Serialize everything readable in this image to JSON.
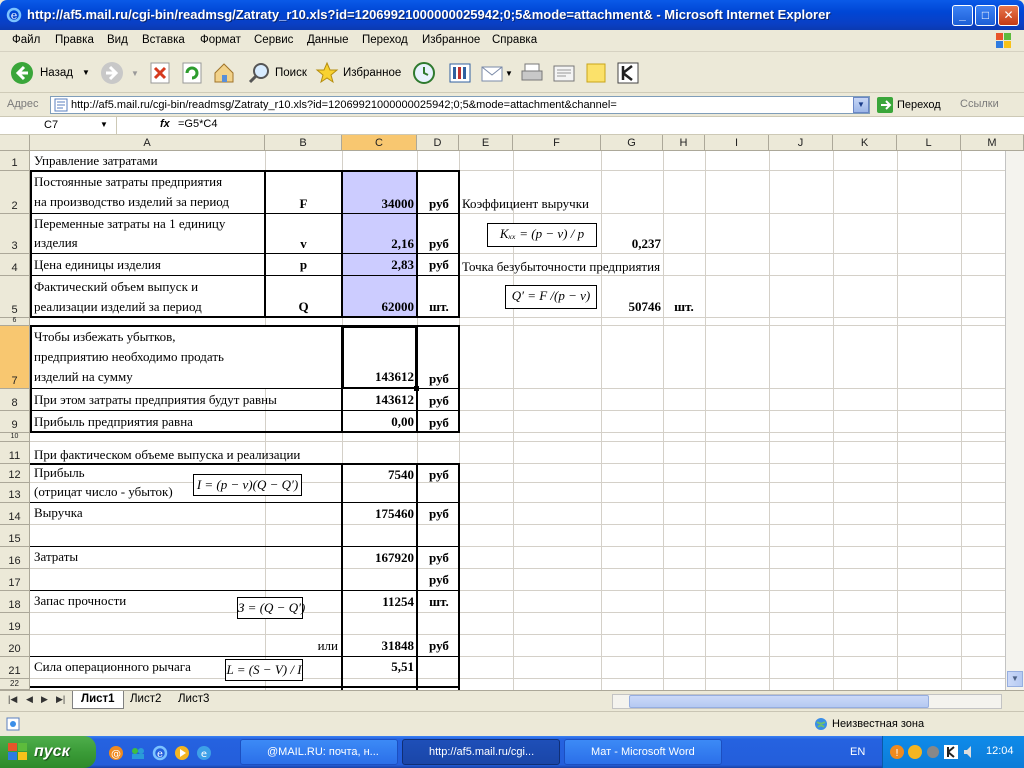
{
  "window": {
    "title": "http://af5.mail.ru/cgi-bin/readmsg/Zatraty_r10.xls?id=12069921000000025942;0;5&mode=attachment& - Microsoft Internet Explorer"
  },
  "menu": [
    "Файл",
    "Правка",
    "Вид",
    "Вставка",
    "Формат",
    "Сервис",
    "Данные",
    "Переход",
    "Избранное",
    "Справка"
  ],
  "toolbar": {
    "back": "Назад",
    "search": "Поиск",
    "favorites": "Избранное"
  },
  "address": {
    "label": "Адрес",
    "url": "http://af5.mail.ru/cgi-bin/readmsg/Zatraty_r10.xls?id=12069921000000025942;0;5&mode=attachment&channel=",
    "go": "Переход",
    "links": "Ссылки"
  },
  "formula_bar": {
    "name_box": "C7",
    "fx": "fx",
    "formula": "=G5*C4"
  },
  "columns": [
    "A",
    "B",
    "C",
    "D",
    "E",
    "F",
    "G",
    "H",
    "I",
    "J",
    "K",
    "L",
    "M"
  ],
  "rows": [
    "1",
    "2",
    "3",
    "4",
    "5",
    "6",
    "7",
    "8",
    "9",
    "10",
    "11",
    "12",
    "13",
    "14",
    "15",
    "16",
    "17",
    "18",
    "19",
    "20",
    "21",
    "22"
  ],
  "sheet": {
    "r1_a": "Управление затратами",
    "r2_a1": "Постоянные затраты предприятия",
    "r2_a2": "на производство изделий за период",
    "r2_b": "F",
    "r2_c": "34000",
    "r2_d": "руб",
    "r2_e": "Коэффициент выручки",
    "r3_a1": "Переменные затраты на 1 единицу",
    "r3_a2": "изделия",
    "r3_b": "v",
    "r3_c": "2,16",
    "r3_d": "руб",
    "r3_formula": "Kₓₓ = (p − v) / p",
    "r3_g": "0,237",
    "r4_a": "Цена единицы изделия",
    "r4_b": "p",
    "r4_c": "2,83",
    "r4_d": "руб",
    "r4_e": "Точка безубыточности предприятия",
    "r5_a1": "Фактический объем выпуск и",
    "r5_a2": "реализации изделий за период",
    "r5_b": "Q",
    "r5_c": "62000",
    "r5_d": "шт.",
    "r5_formula": "Q′ = F /(p − v)",
    "r5_g": "50746",
    "r5_h": "шт.",
    "r7_a1": "Чтобы избежать убытков,",
    "r7_a2": "предприятию  необходимо продать",
    "r7_a3": "изделий на сумму",
    "r7_c": "143612",
    "r7_d": "руб",
    "r8_a": "При этом затраты предприятия будут равны",
    "r8_c": "143612",
    "r8_d": "руб",
    "r9_a": "Прибыль предприятия равна",
    "r9_c": "0,00",
    "r9_d": "руб",
    "r11_a": "При фактическом объеме выпуска и реализации",
    "r12_a": "Прибыль",
    "r12_c": "7540",
    "r12_d": "руб",
    "r13_a": "(отрицат число - убыток)",
    "r13_formula": "I = (p − v)(Q − Q′)",
    "r14_a": "Выручка",
    "r14_c": "175460",
    "r14_d": "руб",
    "r16_a": "Затраты",
    "r16_c": "167920",
    "r16_d": "руб",
    "r17_d": "руб",
    "r18_a": "Запас прочности",
    "r18_formula": "З = (Q − Q′)",
    "r18_c": "11254",
    "r18_d": "шт.",
    "r20_b": "или",
    "r20_c": "31848",
    "r20_d": "руб",
    "r21_a": "Сила операционного рычага",
    "r21_formula": "L = (S − V) / I",
    "r21_c": "5,51"
  },
  "tabs": [
    "Лист1",
    "Лист2",
    "Лист3"
  ],
  "status": {
    "zone": "Неизвестная зона"
  },
  "taskbar": {
    "start": "пуск",
    "tasks": [
      "@MAIL.RU: почта, н...",
      "http://af5.mail.ru/cgi...",
      "Мат - Microsoft Word"
    ],
    "lang": "EN",
    "clock": "12:04"
  },
  "colors": {
    "title_blue": "#0046d5",
    "selected_header": "#f8c770",
    "input_cells": "#ccccff",
    "start_green": "#3b9c38"
  }
}
